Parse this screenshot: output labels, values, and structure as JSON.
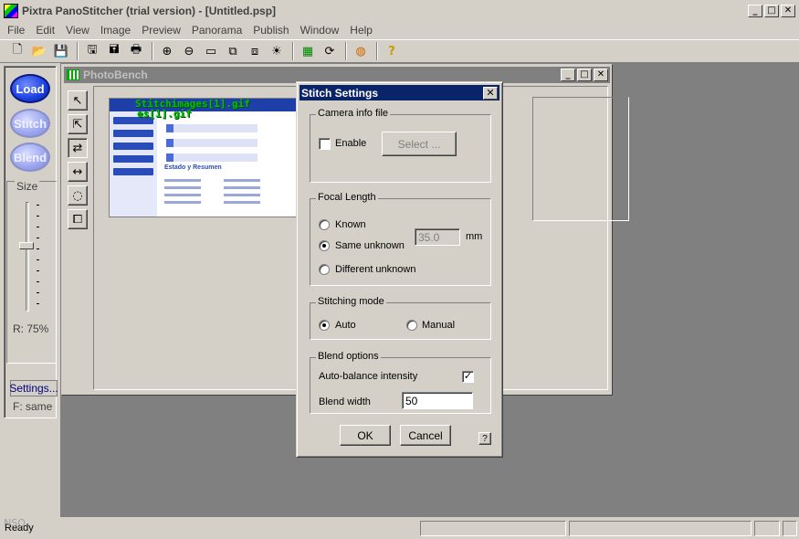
{
  "app": {
    "title": "Pixtra PanoStitcher (trial version) - [Untitled.psp]"
  },
  "menu": [
    "File",
    "Edit",
    "View",
    "Image",
    "Preview",
    "Panorama",
    "Publish",
    "Window",
    "Help"
  ],
  "toolbar": {
    "icons": [
      "new-file-icon",
      "open-folder-icon",
      "save-icon",
      "save-as-icon",
      "print-preview-icon",
      "save-copy-icon",
      "print-icon",
      "zoom-in-icon",
      "zoom-out-icon",
      "fit-rect-icon",
      "arrange-icon",
      "layers-icon",
      "brightness-icon",
      "photobench-icon",
      "rotate-icon",
      "globe-icon",
      "help-icon"
    ]
  },
  "left_panel": {
    "load_label": "Load",
    "stitch_label": "Stitch",
    "blend_label": "Blend",
    "size_label": "Size",
    "ratio_text": "R: 75%",
    "settings_label": "Settings...",
    "focal_status": "F: same"
  },
  "photobench": {
    "title": "PhotoBench",
    "thumbnail_caption_line1": "Stitchimages[1].gif",
    "thumbnail_caption_line2": "es[1].gif",
    "thumb_section": "Estado y Resumen"
  },
  "dialog": {
    "title": "Stitch Settings",
    "camera": {
      "group_label": "Camera info file",
      "enable_label": "Enable",
      "enable_checked": false,
      "select_label": "Select ..."
    },
    "focal": {
      "group_label": "Focal Length",
      "known_label": "Known",
      "same_unknown_label": "Same unknown",
      "different_unknown_label": "Different unknown",
      "selected": "Same unknown",
      "value": "35.0",
      "unit": "mm"
    },
    "stitching": {
      "group_label": "Stitching mode",
      "auto_label": "Auto",
      "manual_label": "Manual",
      "selected": "Auto"
    },
    "blend": {
      "group_label": "Blend options",
      "auto_balance_label": "Auto-balance intensity",
      "auto_balance_checked": true,
      "blend_width_label": "Blend width",
      "blend_width_value": "50"
    },
    "ok_label": "OK",
    "cancel_label": "Cancel",
    "help_label": "?"
  },
  "status": {
    "text": "Ready",
    "overlay": "NSQ"
  }
}
